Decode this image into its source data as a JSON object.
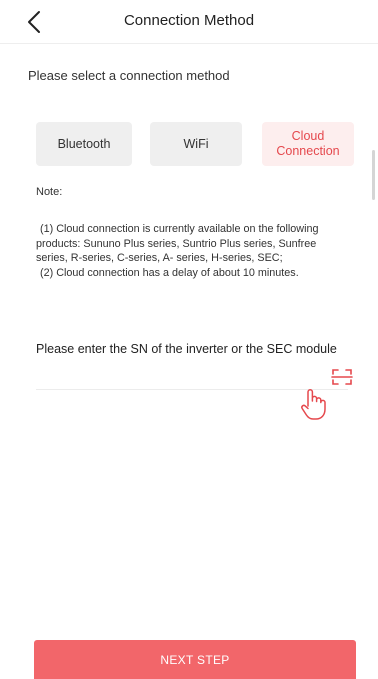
{
  "header": {
    "title": "Connection Method",
    "back_icon": "chevron-left-icon"
  },
  "instruction": "Please select a connection method",
  "methods": [
    {
      "label": "Bluetooth",
      "selected": false
    },
    {
      "label": "WiFi",
      "selected": false
    },
    {
      "label": "Cloud\nConnection",
      "selected": true
    }
  ],
  "note": {
    "title": "Note:",
    "line1": "(1) Cloud connection is currently available on the following products: Sununo Plus series, Suntrio Plus series, Sunfree series, R-series, C-series, A- series, H-series, SEC;",
    "line2": "(2) Cloud connection has a delay of about 10 minutes."
  },
  "sn": {
    "label": "Please enter the SN of the inverter or the SEC module",
    "value": "",
    "placeholder": "",
    "scan_icon": "scan-icon"
  },
  "footer": {
    "next_label": "NEXT STEP"
  },
  "colors": {
    "accent": "#e5484d",
    "accent_bg": "#fdeeee",
    "button": "#f2666a",
    "neutral_bg": "#efefef"
  }
}
